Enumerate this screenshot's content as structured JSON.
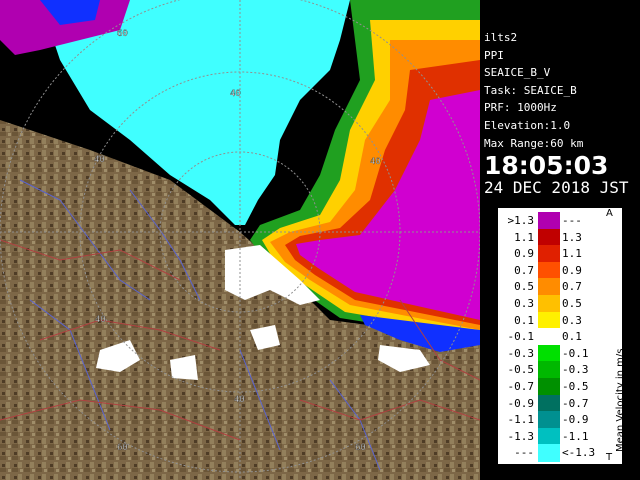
{
  "info": {
    "station": "ilts2",
    "scan_type": "PPI",
    "product": "SEAICE_B_V",
    "task": "Task: SEAICE_B",
    "prf": "PRF: 1000Hz",
    "elevation": "Elevation:1.0",
    "max_range": "Max Range:60 km",
    "time": "18:05:03",
    "date": "24 DEC 2018 JST"
  },
  "legend": {
    "title": "Mean Velocity in m/s",
    "top_mark": "A",
    "bottom_mark": "T",
    "rows": [
      {
        "lo": ">1.3",
        "hi": "---",
        "color": "#b000b0"
      },
      {
        "lo": "1.1",
        "hi": "1.3",
        "color": "#c00000"
      },
      {
        "lo": "0.9",
        "hi": "1.1",
        "color": "#e02000"
      },
      {
        "lo": "0.7",
        "hi": "0.9",
        "color": "#ff5000"
      },
      {
        "lo": "0.5",
        "hi": "0.7",
        "color": "#ff8c00"
      },
      {
        "lo": "0.3",
        "hi": "0.5",
        "color": "#ffc000"
      },
      {
        "lo": "0.1",
        "hi": "0.3",
        "color": "#fff000"
      },
      {
        "lo": "-0.1",
        "hi": "0.1",
        "color": "#ffffff"
      },
      {
        "lo": "-0.3",
        "hi": "-0.1",
        "color": "#00e000"
      },
      {
        "lo": "-0.5",
        "hi": "-0.3",
        "color": "#00b800"
      },
      {
        "lo": "-0.7",
        "hi": "-0.5",
        "color": "#009000"
      },
      {
        "lo": "-0.9",
        "hi": "-0.7",
        "color": "#007060"
      },
      {
        "lo": "-1.1",
        "hi": "-0.9",
        "color": "#009090"
      },
      {
        "lo": "-1.3",
        "hi": "-1.1",
        "color": "#00c0c0"
      },
      {
        "lo": "---",
        "hi": "<-1.3",
        "color": "#40ffff"
      }
    ]
  },
  "range_labels": [
    "40",
    "40",
    "40",
    "40",
    "40",
    "60",
    "60",
    "60"
  ],
  "colors": {
    "land": "#7a6545",
    "land_dark": "#5a4730",
    "sea_ice_cyan": "#40ffff",
    "magenta": "#d000d0",
    "blue": "#1030ff"
  }
}
